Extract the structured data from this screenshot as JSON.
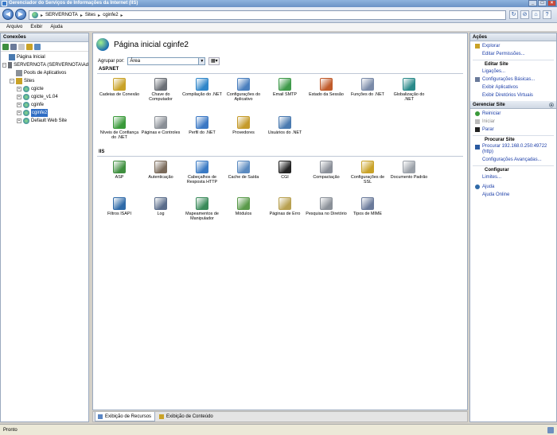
{
  "window": {
    "title": "Gerenciador do Serviços de Informações da Internet (IIS)"
  },
  "address": {
    "segments": [
      "SERVERNOTA",
      "Sites",
      "cginfe2"
    ]
  },
  "menu": {
    "items": [
      "Arquivo",
      "Exibir",
      "Ajuda"
    ]
  },
  "connections": {
    "header": "Conexões",
    "tree": [
      {
        "label": "Página Inicial"
      },
      {
        "label": "SERVERNOTA (SERVERNOTA\\Ad"
      },
      {
        "label": "Pools de Aplicativos"
      },
      {
        "label": "Sites"
      },
      {
        "label": "cgicte"
      },
      {
        "label": "cgicte_v1.04"
      },
      {
        "label": "cginfe"
      },
      {
        "label": "cginfe2"
      },
      {
        "label": "Default Web Site"
      }
    ]
  },
  "main": {
    "title": "Página inicial cginfe2",
    "groupby_label": "Agrupar por:",
    "groupby_value": "Área",
    "sections": [
      {
        "name": "ASP.NET",
        "features": [
          {
            "label": "Cadeias de Conexão",
            "icon": "connection-strings-icon",
            "color": "#c9a227"
          },
          {
            "label": "Chave do Computador",
            "icon": "machine-key-icon",
            "color": "#6b6f76"
          },
          {
            "label": "Compilação do .NET",
            "icon": "net-compilation-icon",
            "color": "#2f86c9"
          },
          {
            "label": "Configurações do Aplicativo",
            "icon": "app-settings-icon",
            "color": "#4a7fbe"
          },
          {
            "label": "Email SMTP",
            "icon": "smtp-email-icon",
            "color": "#3f9a4a"
          },
          {
            "label": "Estado da Sessão",
            "icon": "session-state-icon",
            "color": "#c05a2a"
          },
          {
            "label": "Funções do .NET",
            "icon": "net-roles-icon",
            "color": "#7a8aa8"
          },
          {
            "label": "Globalização do .NET",
            "icon": "net-globalization-icon",
            "color": "#2a8a8a"
          },
          {
            "label": "Níveis de Confiança do .NET",
            "icon": "net-trust-levels-icon",
            "color": "#3a9a3a"
          },
          {
            "label": "Páginas e Controles",
            "icon": "pages-controls-icon",
            "color": "#8a8f96"
          },
          {
            "label": "Perfil do .NET",
            "icon": "net-profile-icon",
            "color": "#3b78c4"
          },
          {
            "label": "Provedores",
            "icon": "providers-icon",
            "color": "#c59b2a"
          },
          {
            "label": "Usuários do .NET",
            "icon": "net-users-icon",
            "color": "#4a7ab0"
          }
        ]
      },
      {
        "name": "IIS",
        "features": [
          {
            "label": "ASP",
            "icon": "asp-icon",
            "color": "#3f8f3f"
          },
          {
            "label": "Autenticação",
            "icon": "authentication-icon",
            "color": "#7a6a5a"
          },
          {
            "label": "Cabeçalhos de Resposta HTTP",
            "icon": "http-headers-icon",
            "color": "#3a7ac4"
          },
          {
            "label": "Cache de Saída",
            "icon": "output-cache-icon",
            "color": "#5a8ac0"
          },
          {
            "label": "CGI",
            "icon": "cgi-icon",
            "color": "#222222"
          },
          {
            "label": "Compactação",
            "icon": "compression-icon",
            "color": "#8a8f98"
          },
          {
            "label": "Configurações de SSL",
            "icon": "ssl-lock-icon",
            "color": "#c9a227"
          },
          {
            "label": "Documento Padrão",
            "icon": "default-document-icon",
            "color": "#9aa0a8"
          },
          {
            "label": "Filtros ISAPI",
            "icon": "isapi-filters-icon",
            "color": "#2f6aa8"
          },
          {
            "label": "Log",
            "icon": "log-icon",
            "color": "#5a6c8a"
          },
          {
            "label": "Mapeamentos de Manipulador",
            "icon": "handler-mappings-icon",
            "color": "#3a8a5a"
          },
          {
            "label": "Módulos",
            "icon": "modules-icon",
            "color": "#5a9a4a"
          },
          {
            "label": "Páginas de Erro",
            "icon": "error-pages-icon",
            "color": "#b8a050"
          },
          {
            "label": "Pesquisa no Diretório",
            "icon": "directory-browsing-icon",
            "color": "#8a9098"
          },
          {
            "label": "Tipos de MIME",
            "icon": "mime-types-icon",
            "color": "#6a7a9a"
          }
        ]
      }
    ]
  },
  "tabs": {
    "features_view": "Exibição de Recursos",
    "content_view": "Exibição de Conteúdo"
  },
  "actions": {
    "header": "Ações",
    "explore": "Explorar",
    "edit_permissions": "Editar Permissões...",
    "edit_site": "Editar Site",
    "bindings": "Ligações...",
    "basic_settings": "Configurações Básicas...",
    "view_applications": "Exibir Aplicativos",
    "view_virtual_dirs": "Exibir Diretórios Virtuais",
    "manage_site": "Gerenciar Site",
    "restart": "Reiniciar",
    "start": "Iniciar",
    "stop": "Parar",
    "browse_site": "Procurar Site",
    "browse_address": "Procurar 192.168.0.250:49722 (http)",
    "advanced_settings": "Configurações Avançadas...",
    "configure": "Configurar",
    "limits": "Limites...",
    "help": "Ajuda",
    "online_help": "Ajuda Online"
  },
  "status": {
    "text": "Pronto"
  }
}
